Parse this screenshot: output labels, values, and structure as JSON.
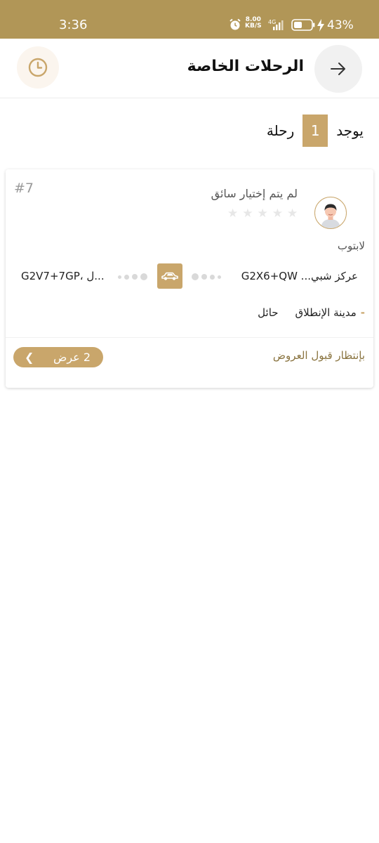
{
  "status_bar": {
    "time": "3:36",
    "speed_value": "8.00",
    "speed_unit": "KB/S",
    "network": "4G",
    "battery": "43%"
  },
  "header": {
    "title": "الرحلات الخاصة",
    "back_icon": "arrow-right-icon",
    "history_icon": "clock-icon"
  },
  "summary": {
    "prefix": "يوجد",
    "count": "1",
    "suffix": "رحلة"
  },
  "trip": {
    "number": "#7",
    "driver_status": "لم يتم إختيار سائق",
    "rating_stars": 5,
    "rating_value": 0,
    "car_type": "لابتوب",
    "from": "عركز شبي... G2X6+QW",
    "to": "G2V7+7GP، ل...",
    "city_label": "مدينة الإنطلاق",
    "city_value": "حائل",
    "status": "بإنتظار قبول العروض",
    "offers_label": "2 عرض"
  },
  "colors": {
    "status_bar": "#b19657",
    "accent": "#c9a66b",
    "status_text": "#8a7440"
  }
}
